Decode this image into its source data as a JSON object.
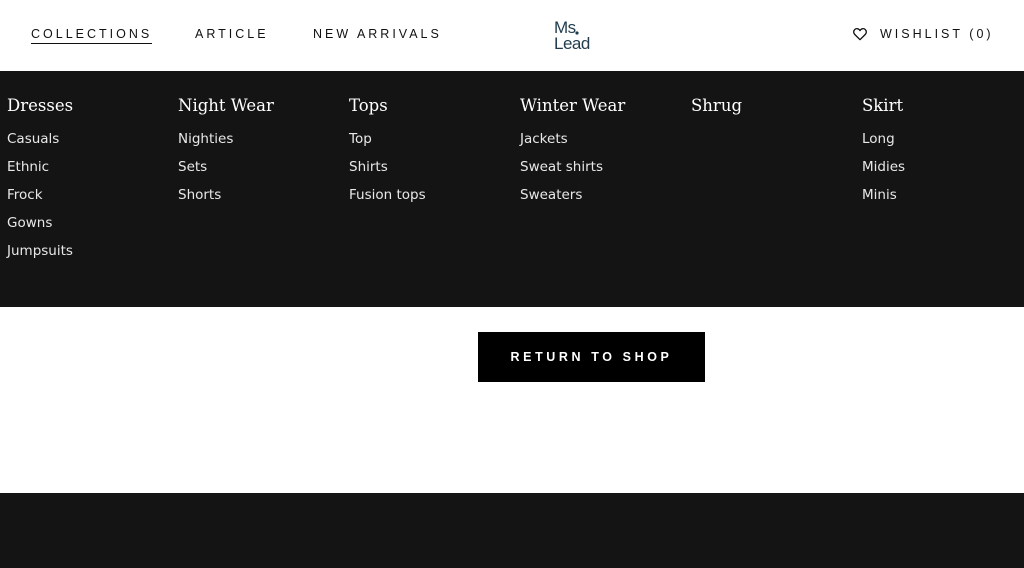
{
  "header": {
    "nav": [
      {
        "label": "COLLECTIONS"
      },
      {
        "label": "ARTICLE"
      },
      {
        "label": "NEW ARRIVALS"
      }
    ],
    "logo_text": "Ms Lead",
    "wishlist_label": "WISHLIST (0)"
  },
  "menu": {
    "columns": [
      {
        "title": "Dresses",
        "items": [
          "Casuals",
          "Ethnic",
          "Frock",
          "Gowns",
          "Jumpsuits"
        ]
      },
      {
        "title": "Night Wear",
        "items": [
          "Nighties",
          "Sets",
          "Shorts"
        ]
      },
      {
        "title": "Tops",
        "items": [
          "Top",
          "Shirts",
          "Fusion tops"
        ]
      },
      {
        "title": "Winter Wear",
        "items": [
          "Jackets",
          "Sweat shirts",
          "Sweaters"
        ]
      },
      {
        "title": "Shrug",
        "items": []
      },
      {
        "title": "Skirt",
        "items": [
          "Long",
          "Midies",
          "Minis"
        ]
      }
    ]
  },
  "main": {
    "return_button_label": "RETURN TO SHOP"
  },
  "colors": {
    "menu_bg": "#141414",
    "logo": "#1f3b4d",
    "button_bg": "#000000"
  },
  "icons": {
    "wishlist": "heart-outline-icon"
  }
}
